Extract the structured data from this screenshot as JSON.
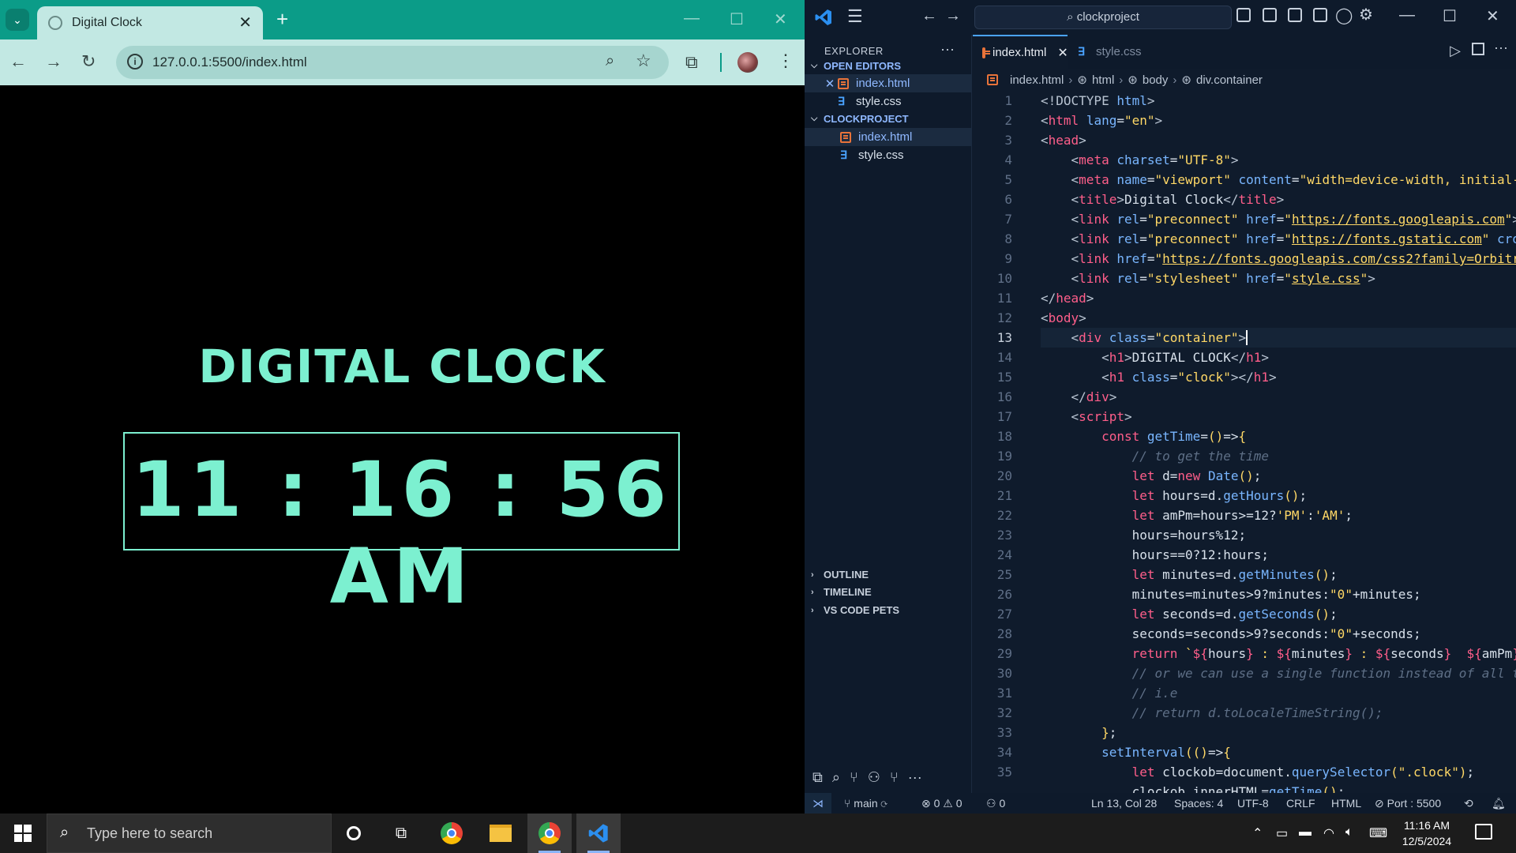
{
  "browser": {
    "tab_title": "Digital Clock",
    "tab_close": "✕",
    "new_tab": "+",
    "url": "127.0.0.1:5500/index.html",
    "page": {
      "heading": "DIGITAL CLOCK",
      "time": "11 : 16 : 56 AM"
    }
  },
  "vscode": {
    "command_center": "clockproject",
    "explorer_title": "EXPLORER",
    "open_editors_label": "OPEN EDITORS",
    "project_label": "CLOCKPROJECT",
    "open_editors": [
      "index.html",
      "style.css"
    ],
    "project_files": [
      "index.html",
      "style.css"
    ],
    "bottom_sections": [
      "OUTLINE",
      "TIMELINE",
      "VS CODE PETS"
    ],
    "tabs": [
      "index.html",
      "style.css"
    ],
    "breadcrumb": [
      "index.html",
      "html",
      "body",
      "div.container"
    ],
    "current_line": 13,
    "line_numbers": [
      "1",
      "2",
      "3",
      "4",
      "5",
      "6",
      "7",
      "8",
      "9",
      "10",
      "11",
      "12",
      "13",
      "14",
      "15",
      "16",
      "17",
      "18",
      "19",
      "20",
      "21",
      "22",
      "23",
      "24",
      "25",
      "26",
      "27",
      "28",
      "29",
      "30",
      "31",
      "32",
      "33",
      "34",
      "35"
    ],
    "status": {
      "branch": "main",
      "problems": "⊗ 0 ⚠ 0",
      "ports_fwd": "0",
      "position": "Ln 13, Col 28",
      "spaces": "Spaces: 4",
      "encoding": "UTF-8",
      "eol": "CRLF",
      "language": "HTML",
      "port": "Port : 5500"
    }
  },
  "taskbar": {
    "search_placeholder": "Type here to search",
    "time": "11:16 AM",
    "date": "12/5/2024"
  },
  "colors": {
    "accent_teal": "#7cf0d0",
    "browser_chrome": "#0b9c88",
    "editor_bg": "#0f1b2c"
  }
}
